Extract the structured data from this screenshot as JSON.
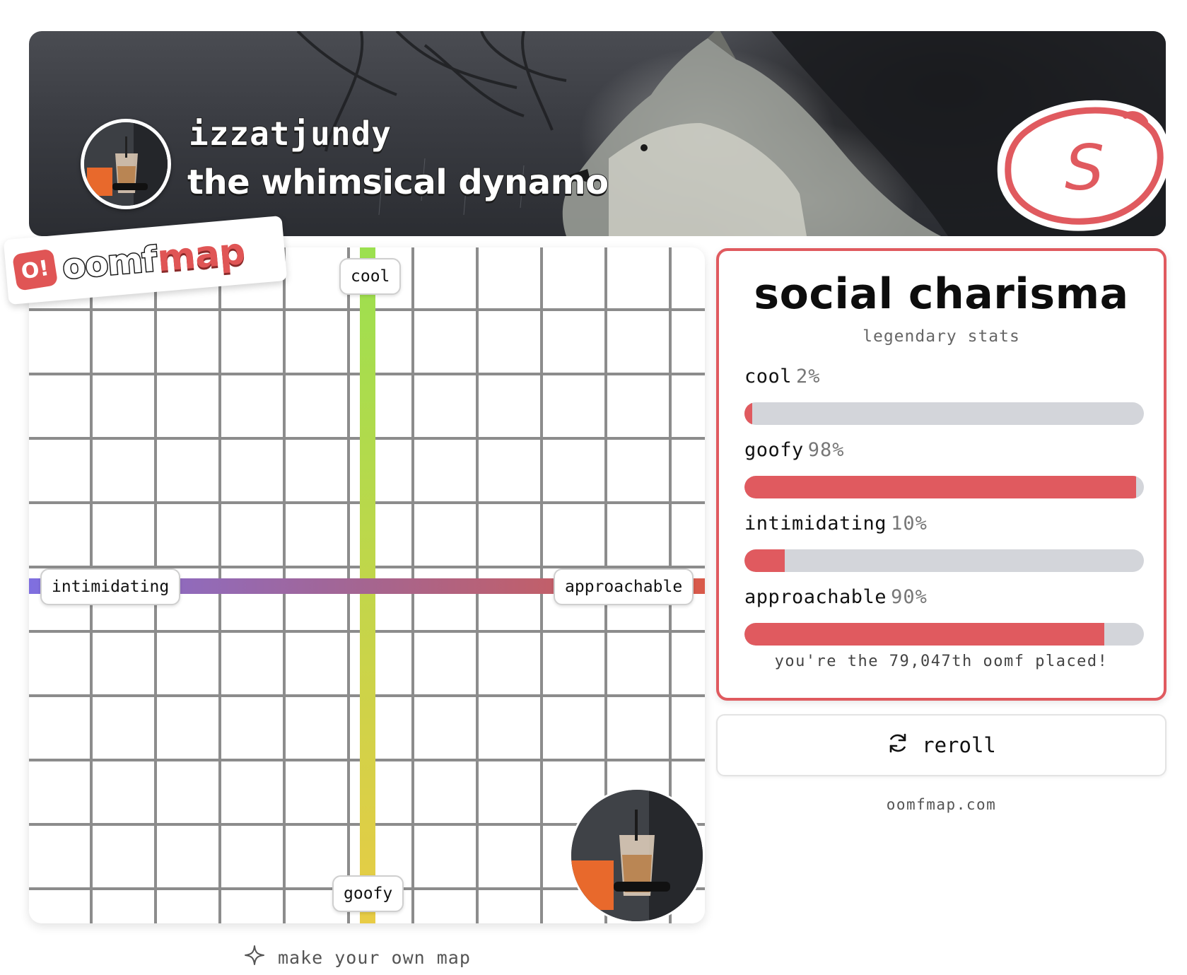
{
  "profile": {
    "username": "izzatjundy",
    "title": "the whimsical dynamo",
    "grade": "S",
    "avatar_icon": "user-photo-iced-coffee"
  },
  "brand": {
    "logo_pin": "O!",
    "logo_part1": "oomf",
    "logo_part2": "map",
    "accent": "#e05a5f"
  },
  "map": {
    "axes": {
      "top": "cool",
      "bottom": "goofy",
      "left": "intimidating",
      "right": "approachable"
    },
    "make_link": "make your own map"
  },
  "stats": {
    "title": "social charisma",
    "subtitle": "legendary stats",
    "items": [
      {
        "label": "cool",
        "percent_text": "2%",
        "value": 0.02
      },
      {
        "label": "goofy",
        "percent_text": "98%",
        "value": 0.98
      },
      {
        "label": "intimidating",
        "percent_text": "10%",
        "value": 0.1
      },
      {
        "label": "approachable",
        "percent_text": "90%",
        "value": 0.9
      }
    ],
    "placed_note": "you're the 79,047th oomf placed!"
  },
  "actions": {
    "reroll_label": "reroll"
  },
  "footer": {
    "site": "oomfmap.com"
  }
}
